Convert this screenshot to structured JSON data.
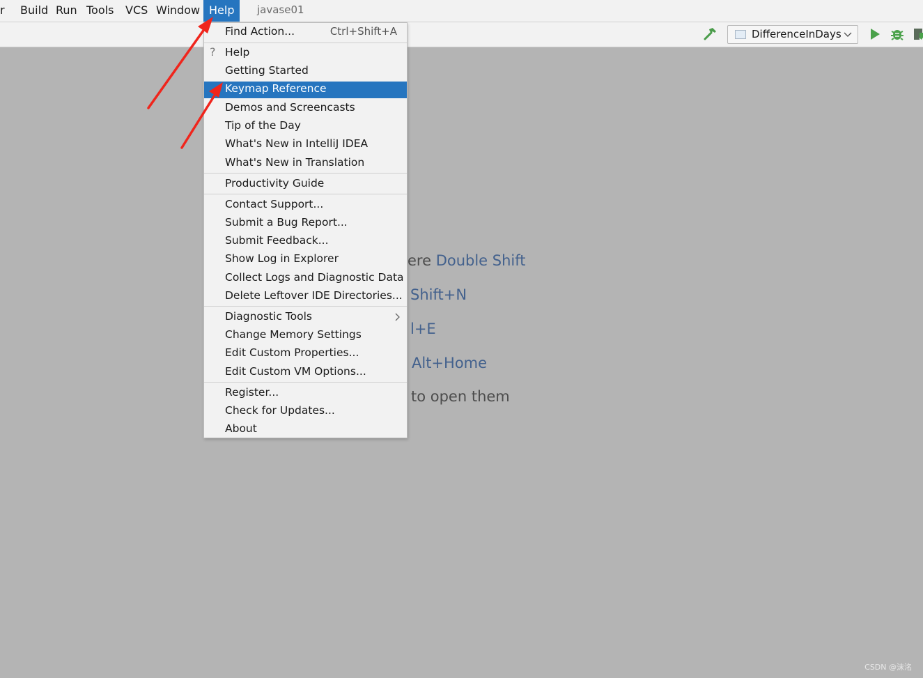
{
  "menubar": {
    "items": [
      {
        "label": "r"
      },
      {
        "label": "Build"
      },
      {
        "label": "Run"
      },
      {
        "label": "Tools"
      },
      {
        "label": "VCS"
      },
      {
        "label": "Window"
      },
      {
        "label": "Help"
      }
    ],
    "project_title": "javase01"
  },
  "toolbar": {
    "run_config": "DifferenceInDays",
    "icons": [
      "build-hammer-icon",
      "run-icon",
      "debug-icon",
      "coverage-icon"
    ]
  },
  "welcome_hints": [
    {
      "text": "ere ",
      "key": "Double Shift"
    },
    {
      "text": "",
      "key": "Shift+N"
    },
    {
      "text": "",
      "key": "l+E"
    },
    {
      "text": "",
      "key": "Alt+Home"
    },
    {
      "text": "to open them",
      "key": ""
    }
  ],
  "help_menu": {
    "items": [
      {
        "label": "Find Action...",
        "shortcut": "Ctrl+Shift+A"
      },
      {
        "label": "Help"
      },
      {
        "label": "Getting Started"
      },
      {
        "label": "Keymap Reference",
        "selected": true
      },
      {
        "label": "Demos and Screencasts"
      },
      {
        "label": "Tip of the Day"
      },
      {
        "label": "What's New in IntelliJ IDEA"
      },
      {
        "label": "What's New in Translation"
      },
      {
        "label": "Productivity Guide"
      },
      {
        "label": "Contact Support..."
      },
      {
        "label": "Submit a Bug Report..."
      },
      {
        "label": "Submit Feedback..."
      },
      {
        "label": "Show Log in Explorer"
      },
      {
        "label": "Collect Logs and Diagnostic Data"
      },
      {
        "label": "Delete Leftover IDE Directories..."
      },
      {
        "label": "Diagnostic Tools",
        "submenu": true
      },
      {
        "label": "Change Memory Settings"
      },
      {
        "label": "Edit Custom Properties..."
      },
      {
        "label": "Edit Custom VM Options..."
      },
      {
        "label": "Register..."
      },
      {
        "label": "Check for Updates..."
      },
      {
        "label": "About"
      }
    ]
  },
  "colors": {
    "selection": "#2675bf",
    "menu_bg": "#f2f2f2",
    "editor_bg": "#b4b4b4",
    "hint_key": "#43618d",
    "annotation_arrow": "#f0251c"
  },
  "watermark": "CSDN @沫洺"
}
